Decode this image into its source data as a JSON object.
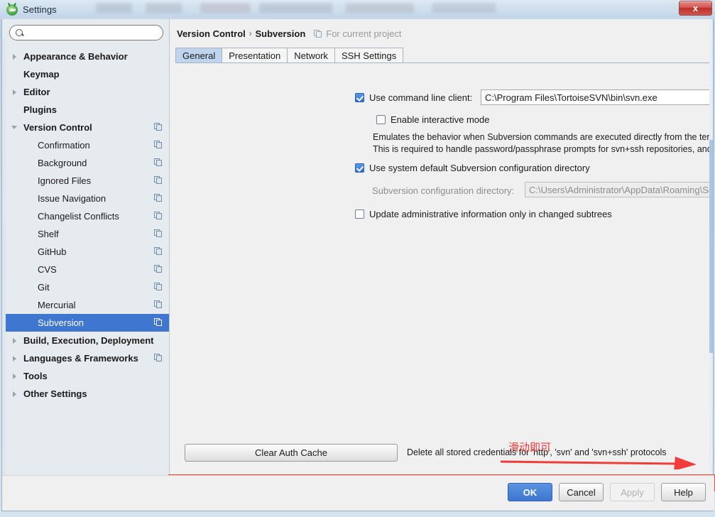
{
  "window": {
    "title": "Settings",
    "app_icon": "android-studio-icon",
    "close_label": "x"
  },
  "sidebar": {
    "search": {
      "value": "",
      "placeholder": "",
      "icon": "search-icon"
    },
    "items": [
      {
        "label": "Appearance & Behavior",
        "arrow": "right",
        "bold": true,
        "child": false,
        "copy_icon": false,
        "selected": false
      },
      {
        "label": "Keymap",
        "arrow": "none",
        "bold": true,
        "child": false,
        "copy_icon": false,
        "selected": false
      },
      {
        "label": "Editor",
        "arrow": "right",
        "bold": true,
        "child": false,
        "copy_icon": false,
        "selected": false
      },
      {
        "label": "Plugins",
        "arrow": "none",
        "bold": true,
        "child": false,
        "copy_icon": false,
        "selected": false
      },
      {
        "label": "Version Control",
        "arrow": "down",
        "bold": true,
        "child": false,
        "copy_icon": true,
        "selected": false
      },
      {
        "label": "Confirmation",
        "arrow": "none",
        "bold": false,
        "child": true,
        "copy_icon": true,
        "selected": false
      },
      {
        "label": "Background",
        "arrow": "none",
        "bold": false,
        "child": true,
        "copy_icon": true,
        "selected": false
      },
      {
        "label": "Ignored Files",
        "arrow": "none",
        "bold": false,
        "child": true,
        "copy_icon": true,
        "selected": false
      },
      {
        "label": "Issue Navigation",
        "arrow": "none",
        "bold": false,
        "child": true,
        "copy_icon": true,
        "selected": false
      },
      {
        "label": "Changelist Conflicts",
        "arrow": "none",
        "bold": false,
        "child": true,
        "copy_icon": true,
        "selected": false
      },
      {
        "label": "Shelf",
        "arrow": "none",
        "bold": false,
        "child": true,
        "copy_icon": true,
        "selected": false
      },
      {
        "label": "GitHub",
        "arrow": "none",
        "bold": false,
        "child": true,
        "copy_icon": true,
        "selected": false
      },
      {
        "label": "CVS",
        "arrow": "none",
        "bold": false,
        "child": true,
        "copy_icon": true,
        "selected": false
      },
      {
        "label": "Git",
        "arrow": "none",
        "bold": false,
        "child": true,
        "copy_icon": true,
        "selected": false
      },
      {
        "label": "Mercurial",
        "arrow": "none",
        "bold": false,
        "child": true,
        "copy_icon": true,
        "selected": false
      },
      {
        "label": "Subversion",
        "arrow": "none",
        "bold": false,
        "child": true,
        "copy_icon": true,
        "selected": true
      },
      {
        "label": "Build, Execution, Deployment",
        "arrow": "right",
        "bold": true,
        "child": false,
        "copy_icon": false,
        "selected": false
      },
      {
        "label": "Languages & Frameworks",
        "arrow": "right",
        "bold": true,
        "child": false,
        "copy_icon": true,
        "selected": false
      },
      {
        "label": "Tools",
        "arrow": "right",
        "bold": true,
        "child": false,
        "copy_icon": false,
        "selected": false
      },
      {
        "label": "Other Settings",
        "arrow": "right",
        "bold": true,
        "child": false,
        "copy_icon": false,
        "selected": false
      }
    ]
  },
  "panel": {
    "breadcrumb": {
      "root": "Version Control",
      "separator": "›",
      "current": "Subversion",
      "scope_note": "For current project",
      "scope_icon": "project-scope-icon"
    },
    "tabs": [
      {
        "label": "General",
        "active": true
      },
      {
        "label": "Presentation",
        "active": false
      },
      {
        "label": "Network",
        "active": false
      },
      {
        "label": "SSH Settings",
        "active": false
      }
    ],
    "use_command_line_client": {
      "label": "Use command line client:",
      "checked": true,
      "path_value": "C:\\Program Files\\TortoiseSVN\\bin\\svn.exe"
    },
    "enable_interactive_mode": {
      "label": "Enable interactive mode",
      "checked": false
    },
    "description_line1": "Emulates the behavior when Subversion commands are executed directly from the terminal (in the interactive mode).",
    "description_line2": "This is required to handle password/passphrase prompts for svn+ssh repositories, and trust invalid server certificates for",
    "use_system_default_config": {
      "label": "Use system default Subversion configuration directory",
      "checked": true
    },
    "config_directory": {
      "label": "Subversion configuration directory:",
      "value": "C:\\Users\\Administrator\\AppData\\Roaming\\Subversion",
      "disabled": true
    },
    "update_admin_info": {
      "label": "Update administrative information only in changed subtrees",
      "checked": false
    },
    "clear_auth_cache": {
      "button_label": "Clear Auth Cache",
      "description": "Delete all stored credentials for 'http', 'svn' and 'svn+ssh' protocols"
    }
  },
  "annotation": {
    "text": "滑动即可",
    "color": "#f23b3b",
    "arrow_icon": "right-arrow-annotation-icon",
    "highlight_target": "horizontal-scrollbar"
  },
  "scrollbar": {
    "orientation": "horizontal",
    "thumb_percent": 85
  },
  "footer": {
    "buttons": [
      {
        "label": "OK",
        "style": "primary",
        "disabled": false
      },
      {
        "label": "Cancel",
        "style": "default",
        "disabled": false
      },
      {
        "label": "Apply",
        "style": "default",
        "disabled": true
      },
      {
        "label": "Help",
        "style": "default",
        "disabled": false
      }
    ]
  }
}
